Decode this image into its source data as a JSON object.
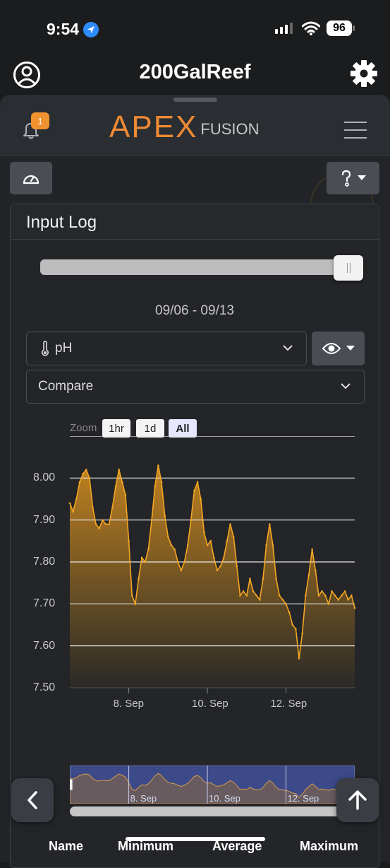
{
  "status_bar": {
    "time": "9:54",
    "battery": "96"
  },
  "header": {
    "title": "200GalReef"
  },
  "apex": {
    "brand": "APEX",
    "brand_suffix": "FUSION",
    "notification_count": "1",
    "accent": "#ee8a34"
  },
  "panel": {
    "title": "Input Log",
    "date_range": "09/06 - 09/13",
    "slider_value": 1.0,
    "input_select": {
      "icon": "thermometer-icon",
      "value": "pH"
    },
    "compare_select": {
      "placeholder": "Compare"
    },
    "zoom": {
      "label": "Zoom",
      "buttons": [
        "1hr",
        "1d",
        "All"
      ],
      "active": "All"
    },
    "stats_headers": [
      "Name",
      "Minimum",
      "Average",
      "Maximum"
    ]
  },
  "chart_data": {
    "type": "area",
    "series": [
      {
        "color": "#f5a623",
        "x": [
          "2023-09-06 12:00",
          "2023-09-06 14:00",
          "2023-09-06 16:00",
          "2023-09-06 18:00",
          "2023-09-06 20:00",
          "2023-09-06 22:00",
          "2023-09-07 00:00",
          "2023-09-07 02:00",
          "2023-09-07 04:00",
          "2023-09-07 06:00",
          "2023-09-07 08:00",
          "2023-09-07 10:00",
          "2023-09-07 12:00",
          "2023-09-07 14:00",
          "2023-09-07 16:00",
          "2023-09-07 18:00",
          "2023-09-07 20:00",
          "2023-09-07 22:00",
          "2023-09-08 00:00",
          "2023-09-08 02:00",
          "2023-09-08 04:00",
          "2023-09-08 06:00",
          "2023-09-08 08:00",
          "2023-09-08 10:00",
          "2023-09-08 12:00",
          "2023-09-08 14:00",
          "2023-09-08 16:00",
          "2023-09-08 18:00",
          "2023-09-08 20:00",
          "2023-09-08 22:00",
          "2023-09-09 00:00",
          "2023-09-09 02:00",
          "2023-09-09 04:00",
          "2023-09-09 06:00",
          "2023-09-09 08:00",
          "2023-09-09 10:00",
          "2023-09-09 12:00",
          "2023-09-09 14:00",
          "2023-09-09 16:00",
          "2023-09-09 18:00",
          "2023-09-09 20:00",
          "2023-09-09 22:00",
          "2023-09-10 00:00",
          "2023-09-10 02:00",
          "2023-09-10 04:00",
          "2023-09-10 06:00",
          "2023-09-10 08:00",
          "2023-09-10 10:00",
          "2023-09-10 12:00",
          "2023-09-10 14:00",
          "2023-09-10 16:00",
          "2023-09-10 18:00",
          "2023-09-10 20:00",
          "2023-09-10 22:00",
          "2023-09-11 00:00",
          "2023-09-11 02:00",
          "2023-09-11 04:00",
          "2023-09-11 06:00",
          "2023-09-11 08:00",
          "2023-09-11 10:00",
          "2023-09-11 12:00",
          "2023-09-11 14:00",
          "2023-09-11 16:00",
          "2023-09-11 18:00",
          "2023-09-11 20:00",
          "2023-09-11 22:00",
          "2023-09-12 00:00",
          "2023-09-12 02:00",
          "2023-09-12 04:00",
          "2023-09-12 06:00",
          "2023-09-12 08:00",
          "2023-09-12 10:00",
          "2023-09-12 12:00",
          "2023-09-12 14:00",
          "2023-09-12 16:00",
          "2023-09-12 18:00",
          "2023-09-12 20:00",
          "2023-09-12 22:00",
          "2023-09-13 00:00",
          "2023-09-13 02:00",
          "2023-09-13 04:00",
          "2023-09-13 06:00",
          "2023-09-13 08:00",
          "2023-09-13 10:00",
          "2023-09-13 12:00",
          "2023-09-13 14:00",
          "2023-09-13 16:00",
          "2023-09-13 18:00"
        ],
        "values": [
          7.94,
          7.92,
          7.95,
          7.99,
          8.01,
          8.02,
          8.0,
          7.93,
          7.89,
          7.88,
          7.9,
          7.89,
          7.89,
          7.93,
          7.98,
          8.02,
          7.99,
          7.96,
          7.85,
          7.72,
          7.7,
          7.76,
          7.81,
          7.8,
          7.83,
          7.9,
          7.98,
          8.03,
          7.99,
          7.91,
          7.86,
          7.84,
          7.83,
          7.8,
          7.78,
          7.8,
          7.84,
          7.9,
          7.97,
          7.99,
          7.95,
          7.87,
          7.84,
          7.85,
          7.81,
          7.78,
          7.79,
          7.81,
          7.85,
          7.89,
          7.86,
          7.79,
          7.72,
          7.73,
          7.72,
          7.76,
          7.73,
          7.72,
          7.71,
          7.76,
          7.84,
          7.89,
          7.84,
          7.76,
          7.72,
          7.71,
          7.7,
          7.68,
          7.65,
          7.64,
          7.57,
          7.63,
          7.72,
          7.77,
          7.83,
          7.78,
          7.72,
          7.73,
          7.72,
          7.7,
          7.73,
          7.72,
          7.71,
          7.72,
          7.73,
          7.71,
          7.72,
          7.69
        ]
      }
    ],
    "x_ticks": [
      "8. Sep",
      "10. Sep",
      "12. Sep"
    ],
    "y_ticks": [
      "7.50",
      "7.60",
      "7.70",
      "7.80",
      "7.90",
      "8.00"
    ],
    "ylim": [
      7.5,
      8.1
    ],
    "grid": true
  }
}
